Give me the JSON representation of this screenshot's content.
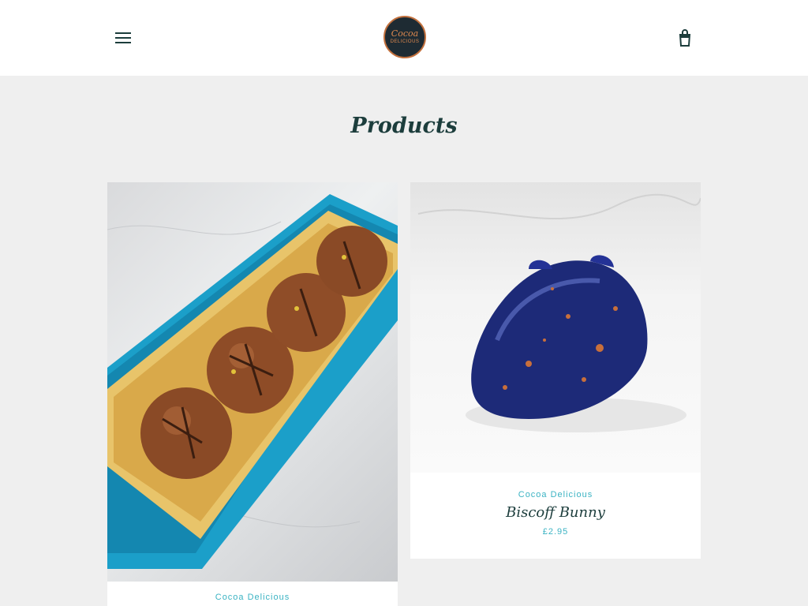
{
  "header": {
    "logo_top": "Cocoa",
    "logo_bottom": "DELICIOUS"
  },
  "page": {
    "title": "Products"
  },
  "products": [
    {
      "vendor": "Cocoa Delicious",
      "name": "",
      "price": ""
    },
    {
      "vendor": "Cocoa Delicious",
      "name": "Biscoff Bunny",
      "price": "£2.95"
    }
  ],
  "colors": {
    "background": "#efefef",
    "header": "#ffffff",
    "heading": "#1c3d3c",
    "accent": "#3bb3c3",
    "box_blue": "#1b9fc9",
    "gold_tray": "#e8c46a",
    "chocolate": "#8a4a26",
    "bunny_blue": "#1d2a78"
  },
  "icons": {
    "menu": "hamburger-menu-icon",
    "cart": "shopping-bag-icon"
  }
}
